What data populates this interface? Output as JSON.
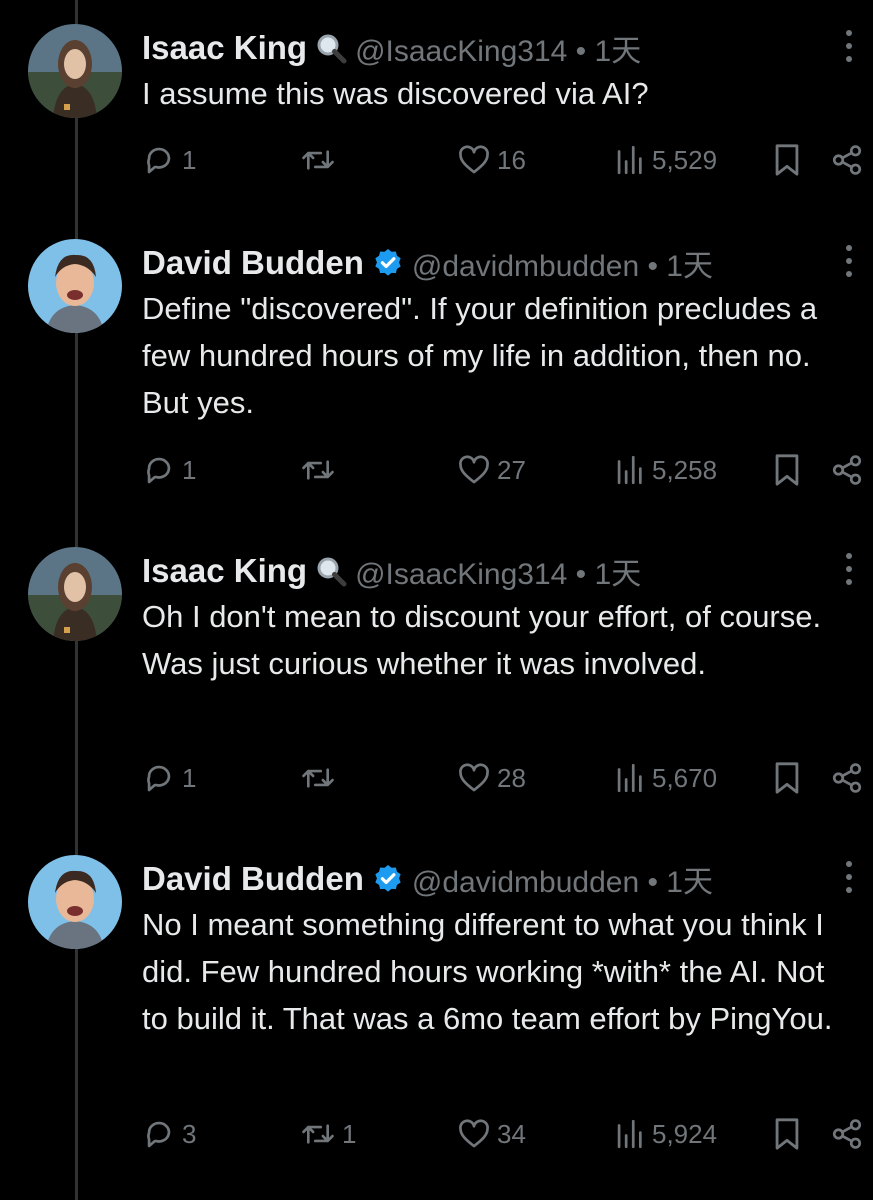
{
  "tweets": [
    {
      "author": "Isaac King",
      "handle_time": "@IsaacKing314 • 1天",
      "badge": "magnifier-icon",
      "text": "I assume this was discovered via AI?",
      "replies": "1",
      "reposts": "",
      "likes": "16",
      "views": "5,529"
    },
    {
      "author": "David Budden",
      "handle_time": "@davidmbudden • 1天",
      "badge": "verified-icon",
      "text": "Define \"discovered\". If your definition precludes a few hundred hours of my life in addition, then no. But yes.",
      "replies": "1",
      "reposts": "",
      "likes": "27",
      "views": "5,258"
    },
    {
      "author": "Isaac King",
      "handle_time": "@IsaacKing314 • 1天",
      "badge": "magnifier-icon",
      "text": "Oh I don't mean to discount your effort, of course. Was just curious whether it was involved.",
      "replies": "1",
      "reposts": "",
      "likes": "28",
      "views": "5,670"
    },
    {
      "author": "David Budden",
      "handle_time": "@davidmbudden • 1天",
      "badge": "verified-icon",
      "text": "No I meant something different to what you think I did. Few hundred hours working *with* the AI. Not to build it. That was a 6mo team effort by PingYou.",
      "replies": "3",
      "reposts": "1",
      "likes": "34",
      "views": "5,924"
    }
  ],
  "colors": {
    "background": "#000000",
    "text": "#e7e9ea",
    "secondary": "#71767b",
    "verified": "#1d9bf0"
  }
}
